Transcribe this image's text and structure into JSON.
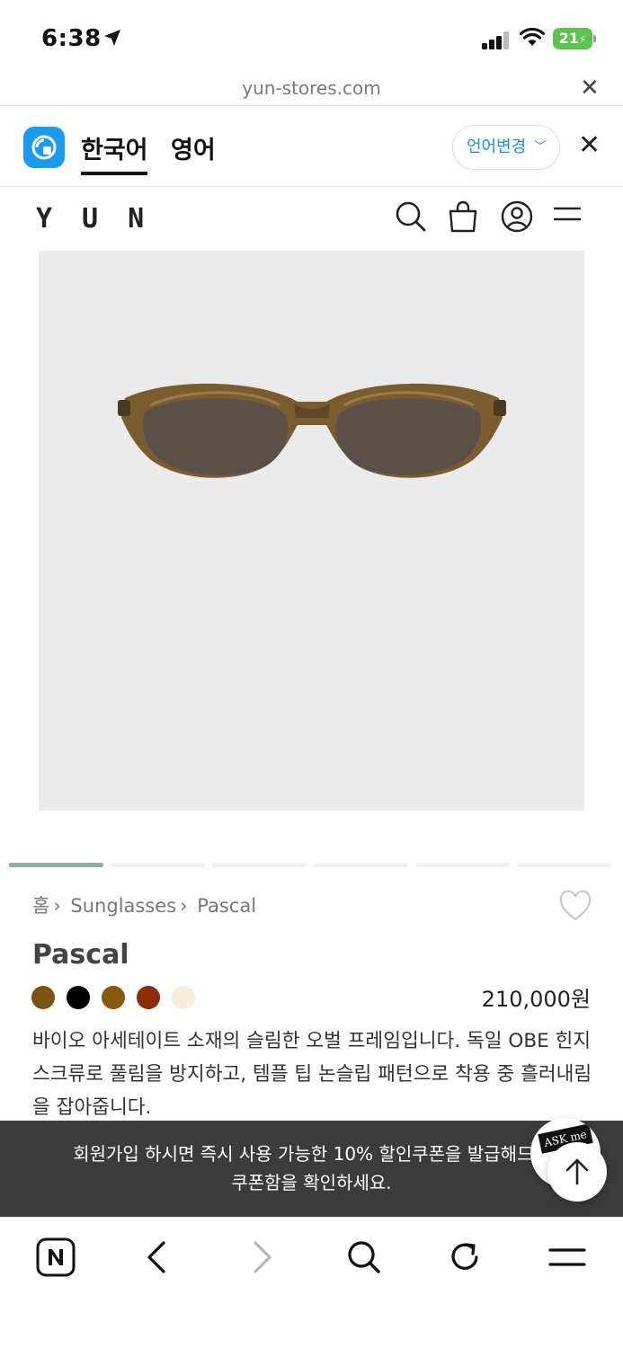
{
  "status": {
    "time": "6:38",
    "battery": "21"
  },
  "url_bar": {
    "domain": "yun-stores.com"
  },
  "translate": {
    "tab_korean": "한국어",
    "tab_english": "영어",
    "change_language": "언어변경",
    "accent_color": "#1f8ee6"
  },
  "site": {
    "logo": "YUN"
  },
  "carousel": {
    "current": 1,
    "total": 6
  },
  "product": {
    "breadcrumb": [
      "홈",
      "Sunglasses",
      "Pascal"
    ],
    "name": "Pascal",
    "price": "210,000원",
    "swatches": [
      "#7a5310",
      "#000000",
      "#875a0d",
      "#8a2c06",
      "#f2eedb"
    ],
    "description": "바이오 아세테이트 소재의 슬림한 오벌 프레임입니다. 독일 OBE 힌지 스크류로 풀림을 방지하고, 템플 팁 논슬립 패턴으로 착용 중 흘러내림을 잡아줍니다."
  },
  "coupon": {
    "line1": "회원가입 하시면 즉시 사용 가능한 10% 할인쿠폰을 발급해드려",
    "line2": "쿠폰함을 확인하세요.",
    "ask_label": "ASK me"
  },
  "toolbar": {
    "icons": [
      "naver-home-icon",
      "back-icon",
      "forward-icon",
      "search-icon",
      "refresh-icon",
      "menu-icon"
    ]
  }
}
